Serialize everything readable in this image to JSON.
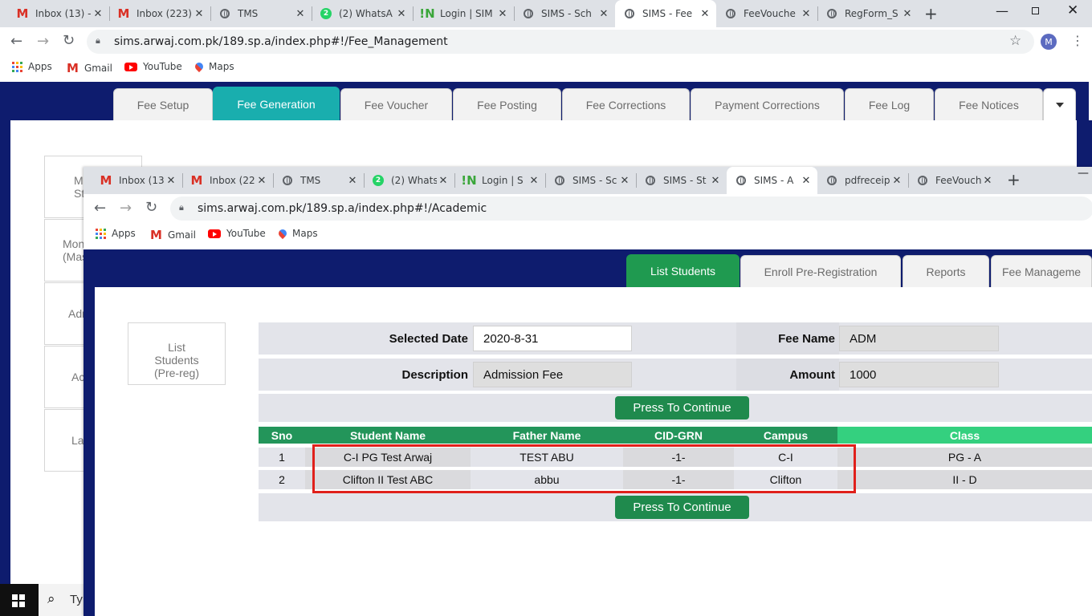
{
  "back_browser": {
    "tabs": [
      {
        "icon": "gmail-icon",
        "title": "Inbox (13) -"
      },
      {
        "icon": "gmail-icon",
        "title": "Inbox (223)"
      },
      {
        "icon": "globe-icon",
        "title": "TMS"
      },
      {
        "icon": "whatsapp-icon",
        "title": "(2) WhatsA"
      },
      {
        "icon": "n-logo-icon",
        "title": "Login | SIM"
      },
      {
        "icon": "globe-icon",
        "title": "SIMS - Sch"
      },
      {
        "icon": "globe-icon",
        "title": "SIMS - Fee"
      },
      {
        "icon": "globe-icon",
        "title": "FeeVouche"
      },
      {
        "icon": "globe-icon",
        "title": "RegForm_S"
      }
    ],
    "active_tab": 6,
    "url": "sims.arwaj.com.pk/189.sp.a/index.php#!/Fee_Management",
    "profile_initial": "M",
    "bookmarks": [
      "Apps",
      "Gmail",
      "YouTube",
      "Maps"
    ],
    "nav_tabs": [
      "Fee Setup",
      "Fee Generation",
      "Fee Voucher",
      "Fee Posting",
      "Fee Corrections",
      "Payment Corrections",
      "Fee Log",
      "Fee Notices"
    ],
    "nav_active": "Fee Generation",
    "side_items": [
      "M\nSta",
      "Mon\n(Mas",
      "Adm",
      "Ac",
      "La"
    ]
  },
  "front_browser": {
    "tabs": [
      {
        "icon": "gmail-icon",
        "title": "Inbox (13"
      },
      {
        "icon": "gmail-icon",
        "title": "Inbox (22"
      },
      {
        "icon": "globe-icon",
        "title": "TMS"
      },
      {
        "icon": "whatsapp-icon",
        "title": "(2) Whats"
      },
      {
        "icon": "n-logo-icon",
        "title": "Login | S"
      },
      {
        "icon": "globe-icon",
        "title": "SIMS - Sc"
      },
      {
        "icon": "globe-icon",
        "title": "SIMS - St"
      },
      {
        "icon": "globe-icon",
        "title": "SIMS - A"
      },
      {
        "icon": "globe-icon",
        "title": "pdfreceip"
      },
      {
        "icon": "globe-icon",
        "title": "FeeVouch"
      }
    ],
    "active_tab": 7,
    "url": "sims.arwaj.com.pk/189.sp.a/index.php#!/Academic",
    "bookmarks": [
      "Apps",
      "Gmail",
      "YouTube",
      "Maps"
    ],
    "nav_tabs": [
      "List Students",
      "Enroll Pre-Registration",
      "Reports",
      "Fee Manageme"
    ],
    "nav_active": "List Students",
    "side_button": "List\nStudents\n(Pre-reg)"
  },
  "form": {
    "selected_date_label": "Selected Date",
    "selected_date_value": "2020-8-31",
    "fee_name_label": "Fee Name",
    "fee_name_value": "ADM",
    "description_label": "Description",
    "description_value": "Admission Fee",
    "amount_label": "Amount",
    "amount_value": "1000",
    "continue_label": "Press To Continue"
  },
  "table": {
    "columns": [
      "Sno",
      "Student Name",
      "Father Name",
      "CID-GRN",
      "Campus",
      "Class"
    ],
    "rows": [
      [
        "1",
        "C-I PG Test Arwaj",
        "TEST ABU",
        "-1-",
        "C-I",
        "PG - A"
      ],
      [
        "2",
        "Clifton II Test ABC",
        "abbu",
        "-1-",
        "Clifton",
        "II - D"
      ]
    ],
    "highlight_color": "#e0201b"
  },
  "taskbar": {
    "search_text": "Ty"
  },
  "colors": {
    "navy": "#0e1c6e",
    "teal": "#19aeae",
    "green_active": "#1f9a50",
    "header_dark": "#23955a",
    "header_light": "#34d07f",
    "button_green": "#1f8a4d"
  }
}
